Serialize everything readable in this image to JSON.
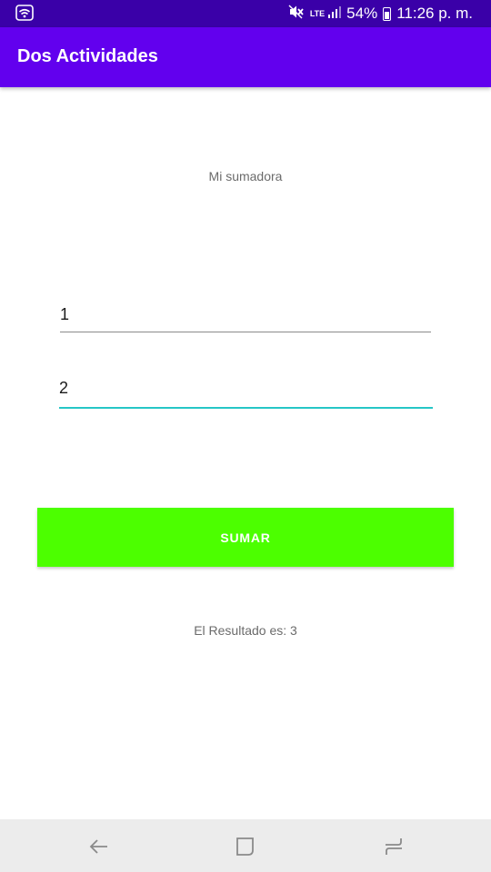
{
  "status_bar": {
    "battery": "54%",
    "time": "11:26 p. m.",
    "network": "LTE",
    "icons": [
      "wifi-icon",
      "mute-icon",
      "lte-icon",
      "signal-icon",
      "battery-icon"
    ]
  },
  "app_bar": {
    "title": "Dos Actividades"
  },
  "main": {
    "heading": "Mi sumadora",
    "field1_value": "1",
    "field2_value": "2",
    "button_label": "SUMAR",
    "result": "El Resultado es: 3"
  },
  "nav_bar": {
    "icons": [
      "back-icon",
      "home-icon",
      "recent-apps-icon"
    ]
  },
  "colors": {
    "status_bar": "#3a00a8",
    "app_bar": "#6200ee",
    "button": "#4cff00",
    "focused_underline": "#26c6c6"
  }
}
